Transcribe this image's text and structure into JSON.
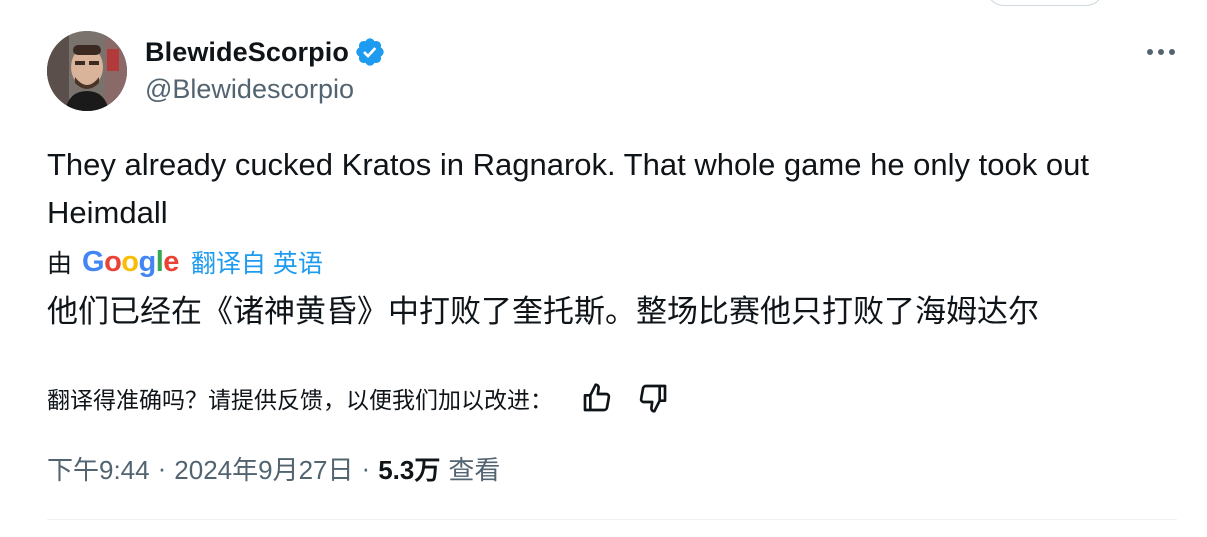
{
  "author": {
    "display_name": "BlewideScorpio",
    "handle": "@Blewidescorpio",
    "verified": true,
    "verified_color": "#1d9bf0",
    "avatar_icon": "avatar-photo"
  },
  "tweet": {
    "text": "They already cucked Kratos in Ragnarok. That whole game he only took out Heimdall"
  },
  "translation": {
    "by_prefix": "由",
    "provider_logo_text": "Google",
    "link_label": "翻译自 英语",
    "link_color": "#1d9bf0",
    "text": "他们已经在《诸神黄昏》中打败了奎托斯。整场比赛他只打败了海姆达尔",
    "feedback_prompt": "翻译得准确吗？请提供反馈，以便我们加以改进："
  },
  "meta": {
    "time": "下午9:44",
    "separator": "·",
    "date": "2024年9月27日",
    "views_count": "5.3万",
    "views_label": "查看"
  },
  "icons": {
    "more": "more-horizontal-icon",
    "thumbs_up": "thumbs-up-icon",
    "thumbs_down": "thumbs-down-icon",
    "verified": "verified-badge-icon"
  },
  "colors": {
    "text_primary": "#0f1419",
    "text_secondary": "#536471",
    "divider": "#eff3f4",
    "google_blue": "#4285f4",
    "google_red": "#ea4335",
    "google_yellow": "#fbbc05",
    "google_green": "#34a853"
  }
}
